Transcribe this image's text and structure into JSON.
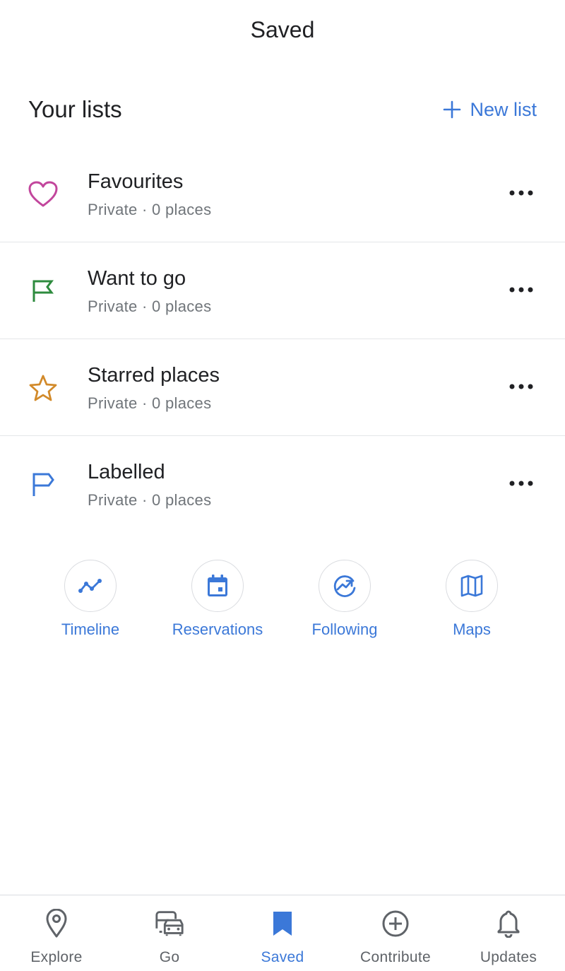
{
  "header": {
    "title": "Saved"
  },
  "lists_section": {
    "title": "Your lists",
    "new_list_label": "New list",
    "accent_color": "#3b78d8"
  },
  "lists": [
    {
      "name": "Favourites",
      "meta": "Private · 0 places",
      "icon": "heart-icon",
      "icon_color": "#c2469c"
    },
    {
      "name": "Want to go",
      "meta": "Private · 0 places",
      "icon": "flag-icon",
      "icon_color": "#2e8b3e"
    },
    {
      "name": "Starred places",
      "meta": "Private · 0 places",
      "icon": "star-icon",
      "icon_color": "#d28a2a"
    },
    {
      "name": "Labelled",
      "meta": "Private · 0 places",
      "icon": "label-flag-icon",
      "icon_color": "#3b78d8"
    }
  ],
  "shortcuts": [
    {
      "label": "Timeline",
      "icon": "timeline-icon"
    },
    {
      "label": "Reservations",
      "icon": "calendar-icon"
    },
    {
      "label": "Following",
      "icon": "trending-icon"
    },
    {
      "label": "Maps",
      "icon": "map-icon"
    }
  ],
  "bottom_nav": {
    "items": [
      {
        "label": "Explore",
        "icon": "location-pin-icon",
        "active": false
      },
      {
        "label": "Go",
        "icon": "car-bus-icon",
        "active": false
      },
      {
        "label": "Saved",
        "icon": "bookmark-icon",
        "active": true
      },
      {
        "label": "Contribute",
        "icon": "add-circle-icon",
        "active": false
      },
      {
        "label": "Updates",
        "icon": "bell-icon",
        "active": false
      }
    ]
  }
}
